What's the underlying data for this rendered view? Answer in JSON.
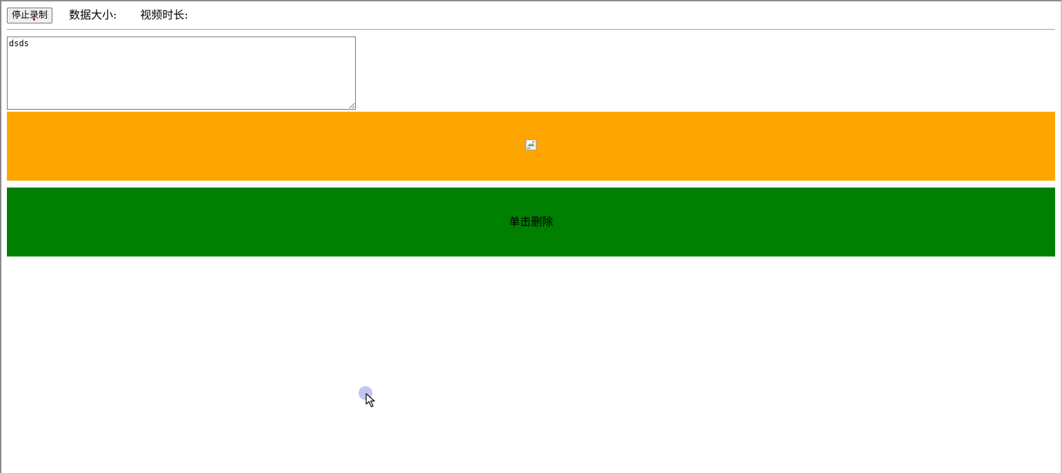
{
  "toolbar": {
    "stop_label": "停止录制",
    "data_size_label": "数据大小:",
    "video_duration_label": "视频时长:"
  },
  "editor": {
    "value": "dsds"
  },
  "media_panel": {
    "background": "#ffa500",
    "image_icon": "broken-image-icon"
  },
  "delete_panel": {
    "background": "#008000",
    "label": "单击删除"
  },
  "pointer": {
    "icon": "mouse-pointer-icon",
    "halo_color": "#9696e6"
  }
}
